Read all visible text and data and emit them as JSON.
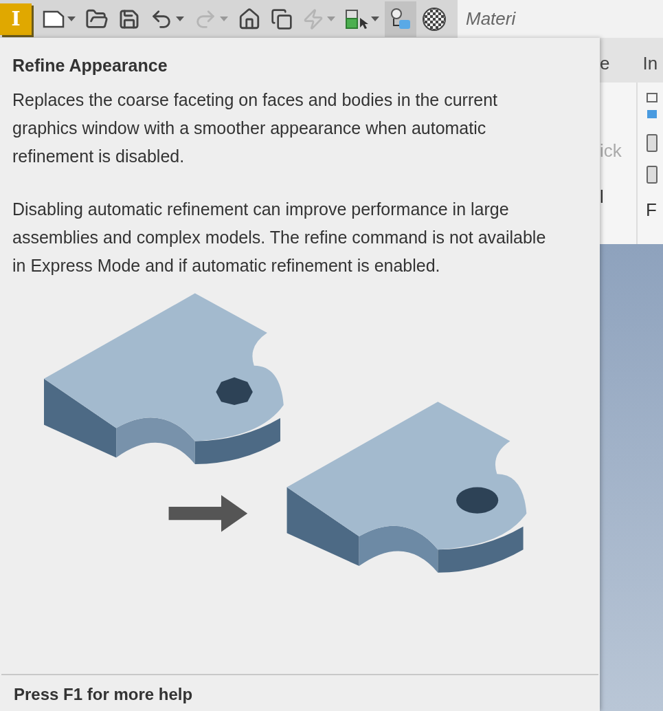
{
  "toolbar": {
    "buttons": [
      {
        "kind": "app",
        "label": "I"
      },
      {
        "kind": "new",
        "disabled": false,
        "selected": false,
        "dropdown": true
      },
      {
        "kind": "open",
        "disabled": false,
        "selected": false,
        "dropdown": false
      },
      {
        "kind": "save",
        "disabled": false,
        "selected": false,
        "dropdown": false
      },
      {
        "kind": "undo",
        "disabled": false,
        "selected": false,
        "dropdown": true
      },
      {
        "kind": "redo",
        "disabled": true,
        "selected": false,
        "dropdown": true
      },
      {
        "kind": "home",
        "disabled": false,
        "selected": false,
        "dropdown": false
      },
      {
        "kind": "windows",
        "disabled": false,
        "selected": false,
        "dropdown": false
      },
      {
        "kind": "update",
        "disabled": true,
        "selected": false,
        "dropdown": true
      },
      {
        "kind": "select",
        "disabled": false,
        "selected": false,
        "dropdown": true
      },
      {
        "kind": "refine",
        "disabled": false,
        "selected": true,
        "dropdown": false
      },
      {
        "kind": "appearance",
        "disabled": false,
        "selected": false,
        "dropdown": false
      }
    ],
    "material_field": {
      "value": "Materi"
    }
  },
  "tooltip": {
    "title": "Refine Appearance",
    "paragraphs": [
      "Replaces the coarse faceting on faces and bodies in the current graphics window with a smoother appearance when automatic refinement is disabled.",
      "Disabling automatic refinement can improve performance in large assemblies and complex models. The refine command is not available in Express Mode and if automatic refinement is enabled."
    ],
    "footer": "Press F1 for more help"
  },
  "ribbon": {
    "tabs": [
      "e",
      "In"
    ],
    "commands": [
      {
        "label": "ick",
        "disabled": true
      },
      {
        "label": "l",
        "disabled": false
      }
    ],
    "panel_label": "F"
  }
}
